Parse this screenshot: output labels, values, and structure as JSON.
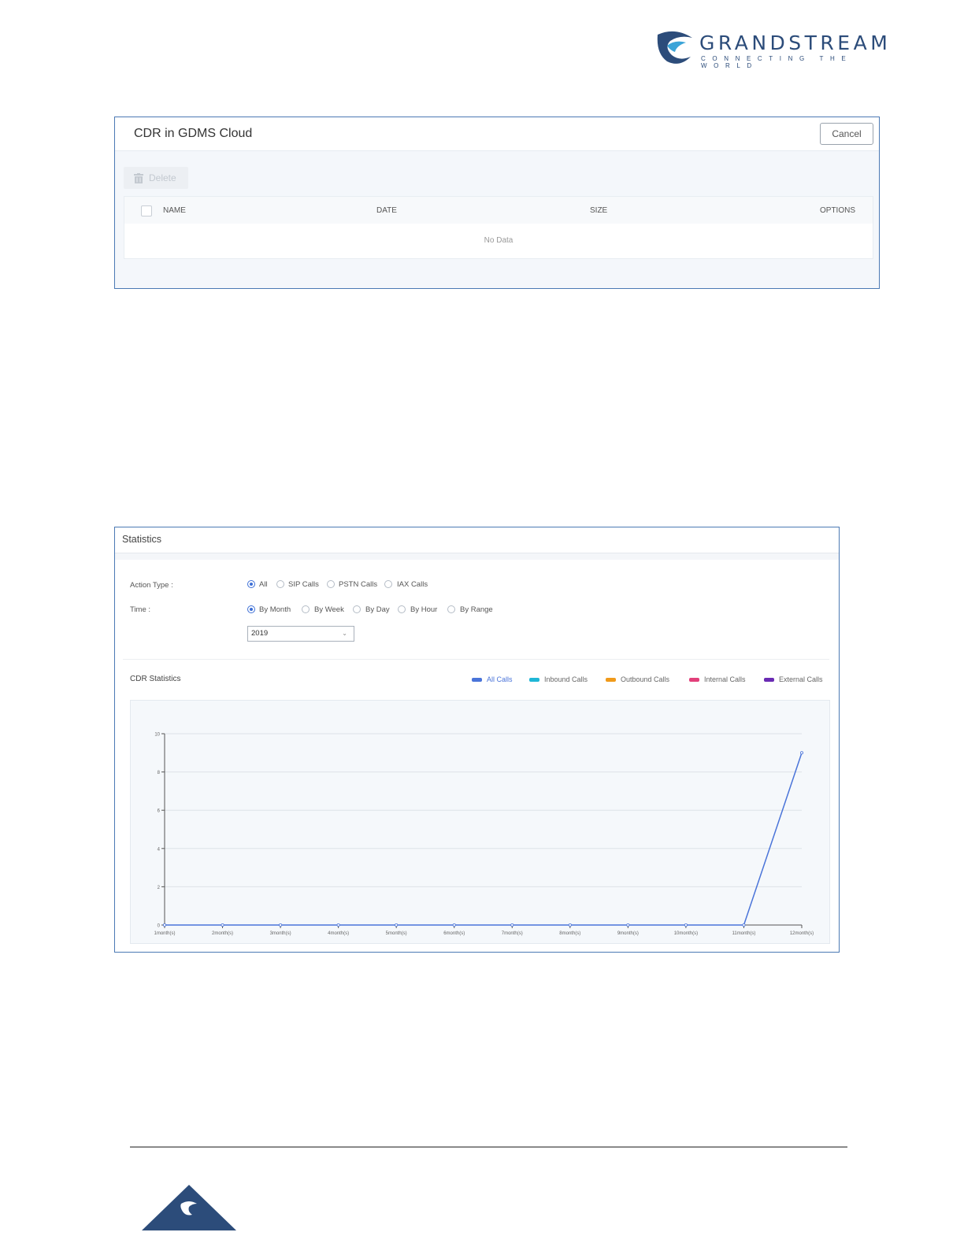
{
  "header": {
    "brand_name": "GRANDSTREAM",
    "brand_tagline": "CONNECTING THE WORLD",
    "brand_color": "#2c4c7a"
  },
  "cdr_dialog": {
    "title": "CDR in GDMS Cloud",
    "cancel_label": "Cancel",
    "delete_label": "Delete",
    "columns": [
      "NAME",
      "DATE",
      "SIZE",
      "OPTIONS"
    ],
    "empty_text": "No Data",
    "border_color": "#4b79b4"
  },
  "statistics": {
    "title": "Statistics",
    "action_type_label": "Action Type :",
    "action_types": [
      {
        "label": "All",
        "selected": true
      },
      {
        "label": "SIP Calls",
        "selected": false
      },
      {
        "label": "PSTN Calls",
        "selected": false
      },
      {
        "label": "IAX Calls",
        "selected": false
      }
    ],
    "time_label": "Time :",
    "time_options": [
      {
        "label": "By Month",
        "selected": true
      },
      {
        "label": "By Week",
        "selected": false
      },
      {
        "label": "By Day",
        "selected": false
      },
      {
        "label": "By Hour",
        "selected": false
      },
      {
        "label": "By Range",
        "selected": false
      }
    ],
    "year_value": "2019",
    "cdr_statistics_label": "CDR Statistics",
    "legend": [
      {
        "label": "All Calls",
        "color": "#4a74d9",
        "active": true
      },
      {
        "label": "Inbound Calls",
        "color": "#1fb6d6",
        "active": false
      },
      {
        "label": "Outbound Calls",
        "color": "#f09a1a",
        "active": false
      },
      {
        "label": "Internal Calls",
        "color": "#e23f7a",
        "active": false
      },
      {
        "label": "External Calls",
        "color": "#6a2bb3",
        "active": false
      }
    ]
  },
  "chart_data": {
    "type": "line",
    "categories": [
      "1month(s)",
      "2month(s)",
      "3month(s)",
      "4month(s)",
      "5month(s)",
      "6month(s)",
      "7month(s)",
      "8month(s)",
      "9month(s)",
      "10month(s)",
      "11month(s)",
      "12month(s)"
    ],
    "series": [
      {
        "name": "All Calls",
        "values": [
          0,
          0,
          0,
          0,
          0,
          0,
          0,
          0,
          0,
          0,
          0,
          9
        ],
        "color": "#4a74d9"
      }
    ],
    "yticks": [
      "0",
      "2",
      "4",
      "6",
      "8",
      "10"
    ],
    "ylim": [
      0,
      10
    ],
    "grid": true
  }
}
